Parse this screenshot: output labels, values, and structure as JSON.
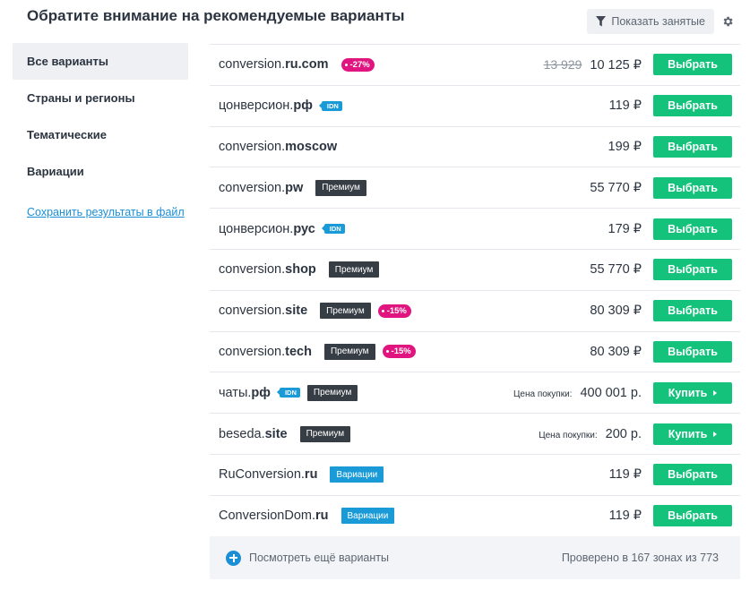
{
  "header": {
    "title": "Обратите внимание на рекомендуемые варианты",
    "show_busy_label": "Показать занятые",
    "filter_icon": "filter-icon",
    "settings_icon": "gear-icon"
  },
  "sidebar": {
    "items": [
      {
        "label": "Все варианты",
        "active": true
      },
      {
        "label": "Страны и регионы",
        "active": false
      },
      {
        "label": "Тематические",
        "active": false
      },
      {
        "label": "Вариации",
        "active": false
      }
    ],
    "save_link": "Сохранить результаты в файл"
  },
  "rows": [
    {
      "sld": "conversion.",
      "tld": "ru.com",
      "tags": [
        {
          "type": "disc",
          "text": "-27%"
        }
      ],
      "old_price": "13 929",
      "price": "10 125 ₽",
      "price_label": "",
      "button": "Выбрать",
      "buy": false
    },
    {
      "sld": "цонверсион.",
      "tld": "рф",
      "tags": [
        {
          "type": "idn",
          "text": "IDN"
        }
      ],
      "old_price": "",
      "price": "119 ₽",
      "price_label": "",
      "button": "Выбрать",
      "buy": false
    },
    {
      "sld": "conversion.",
      "tld": "moscow",
      "tags": [],
      "old_price": "",
      "price": "199 ₽",
      "price_label": "",
      "button": "Выбрать",
      "buy": false
    },
    {
      "sld": "conversion.",
      "tld": "pw",
      "tags": [
        {
          "type": "premium",
          "text": "Премиум"
        }
      ],
      "old_price": "",
      "price": "55 770 ₽",
      "price_label": "",
      "button": "Выбрать",
      "buy": false
    },
    {
      "sld": "цонверсион.",
      "tld": "рус",
      "tags": [
        {
          "type": "idn",
          "text": "IDN"
        }
      ],
      "old_price": "",
      "price": "179 ₽",
      "price_label": "",
      "button": "Выбрать",
      "buy": false
    },
    {
      "sld": "conversion.",
      "tld": "shop",
      "tags": [
        {
          "type": "premium",
          "text": "Премиум"
        }
      ],
      "old_price": "",
      "price": "55 770 ₽",
      "price_label": "",
      "button": "Выбрать",
      "buy": false
    },
    {
      "sld": "conversion.",
      "tld": "site",
      "tags": [
        {
          "type": "premium",
          "text": "Премиум"
        },
        {
          "type": "disc",
          "text": "-15%"
        }
      ],
      "old_price": "",
      "price": "80 309 ₽",
      "price_label": "",
      "button": "Выбрать",
      "buy": false
    },
    {
      "sld": "conversion.",
      "tld": "tech",
      "tags": [
        {
          "type": "premium",
          "text": "Премиум"
        },
        {
          "type": "disc",
          "text": "-15%"
        }
      ],
      "old_price": "",
      "price": "80 309 ₽",
      "price_label": "",
      "button": "Выбрать",
      "buy": false
    },
    {
      "sld": "чаты.",
      "tld": "рф",
      "tags": [
        {
          "type": "idn",
          "text": "IDN"
        },
        {
          "type": "premium",
          "text": "Премиум"
        }
      ],
      "old_price": "",
      "price": "400 001 р.",
      "price_label": "Цена покупки:",
      "button": "Купить",
      "buy": true
    },
    {
      "sld": "beseda.",
      "tld": "site",
      "tags": [
        {
          "type": "premium",
          "text": "Премиум"
        }
      ],
      "old_price": "",
      "price": "200 р.",
      "price_label": "Цена покупки:",
      "button": "Купить",
      "buy": true
    },
    {
      "sld": "RuConversion.",
      "tld": "ru",
      "tags": [
        {
          "type": "var",
          "text": "Вариации"
        }
      ],
      "old_price": "",
      "price": "119 ₽",
      "price_label": "",
      "button": "Выбрать",
      "buy": false
    },
    {
      "sld": "ConversionDom.",
      "tld": "ru",
      "tags": [
        {
          "type": "var",
          "text": "Вариации"
        }
      ],
      "old_price": "",
      "price": "119 ₽",
      "price_label": "",
      "button": "Выбрать",
      "buy": false
    }
  ],
  "footer": {
    "more_label": "Посмотреть ещё варианты",
    "checked_text": "Проверено в 167 зонах из 773"
  },
  "colors": {
    "accent_green": "#15c27c",
    "discount": "#e0157f",
    "idn": "#1a9bd7",
    "premium": "#363d45",
    "link": "#1a8fd6"
  }
}
